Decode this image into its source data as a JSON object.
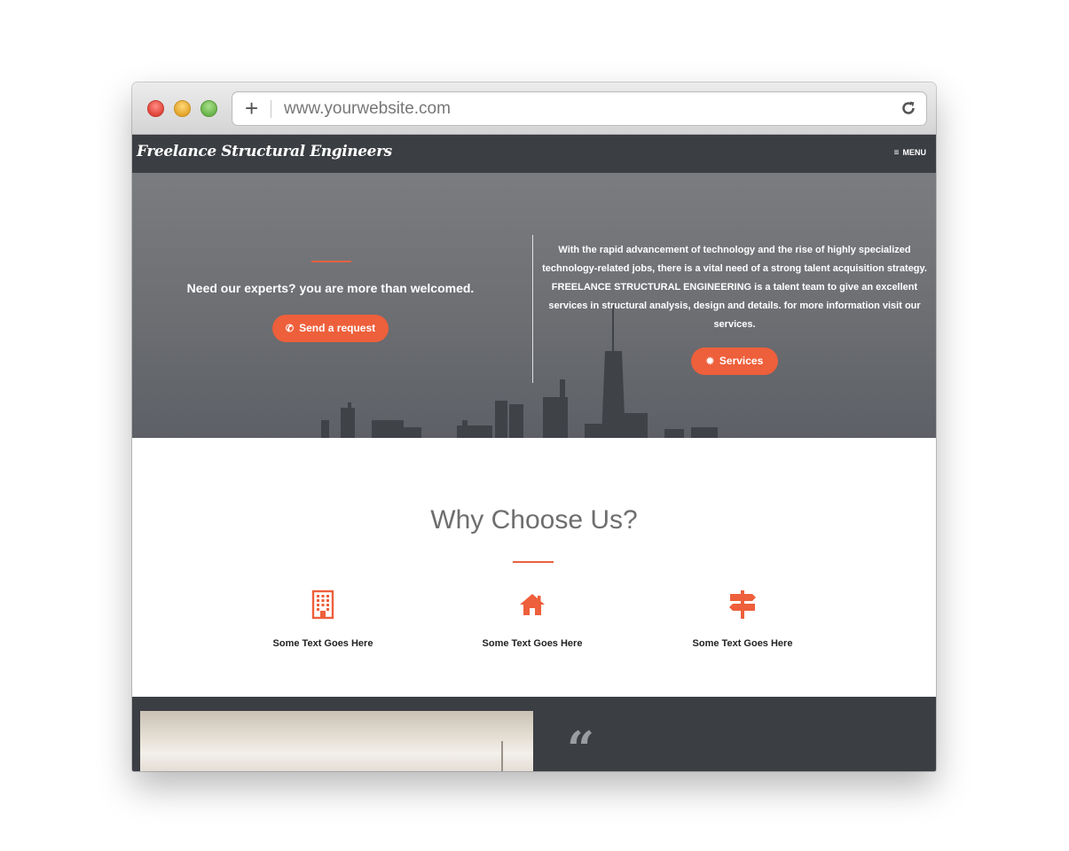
{
  "browser": {
    "url": "www.yourwebsite.com",
    "plus_label": "+"
  },
  "navbar": {
    "brand": "Freelance Structural Engineers",
    "menu_label": "MENU",
    "menu_icon": "hamburger-icon"
  },
  "hero": {
    "left_heading": "Need our experts? you are more than welcomed.",
    "request_button": "Send a request",
    "request_icon": "phone-icon",
    "right_text": "With the rapid advancement of technology and the rise of highly specialized technology-related jobs, there is a vital need of a strong talent acquisition strategy. FREELANCE STRUCTURAL ENGINEERING is a talent team to give an excellent services in structural analysis, design and details. for more information visit our services.",
    "services_button": "Services",
    "services_icon": "gear-icon"
  },
  "why": {
    "title": "Why Choose Us?",
    "features": [
      {
        "icon": "building-icon",
        "text": "Some Text Goes Here"
      },
      {
        "icon": "home-icon",
        "text": "Some Text Goes Here"
      },
      {
        "icon": "signpost-icon",
        "text": "Some Text Goes Here"
      }
    ]
  },
  "testimonial": {
    "quote_icon": "quote-left-icon"
  },
  "colors": {
    "accent": "#ee5f3b",
    "navbar_bg": "#3b3e43",
    "title_gray": "#6e6e6e"
  }
}
